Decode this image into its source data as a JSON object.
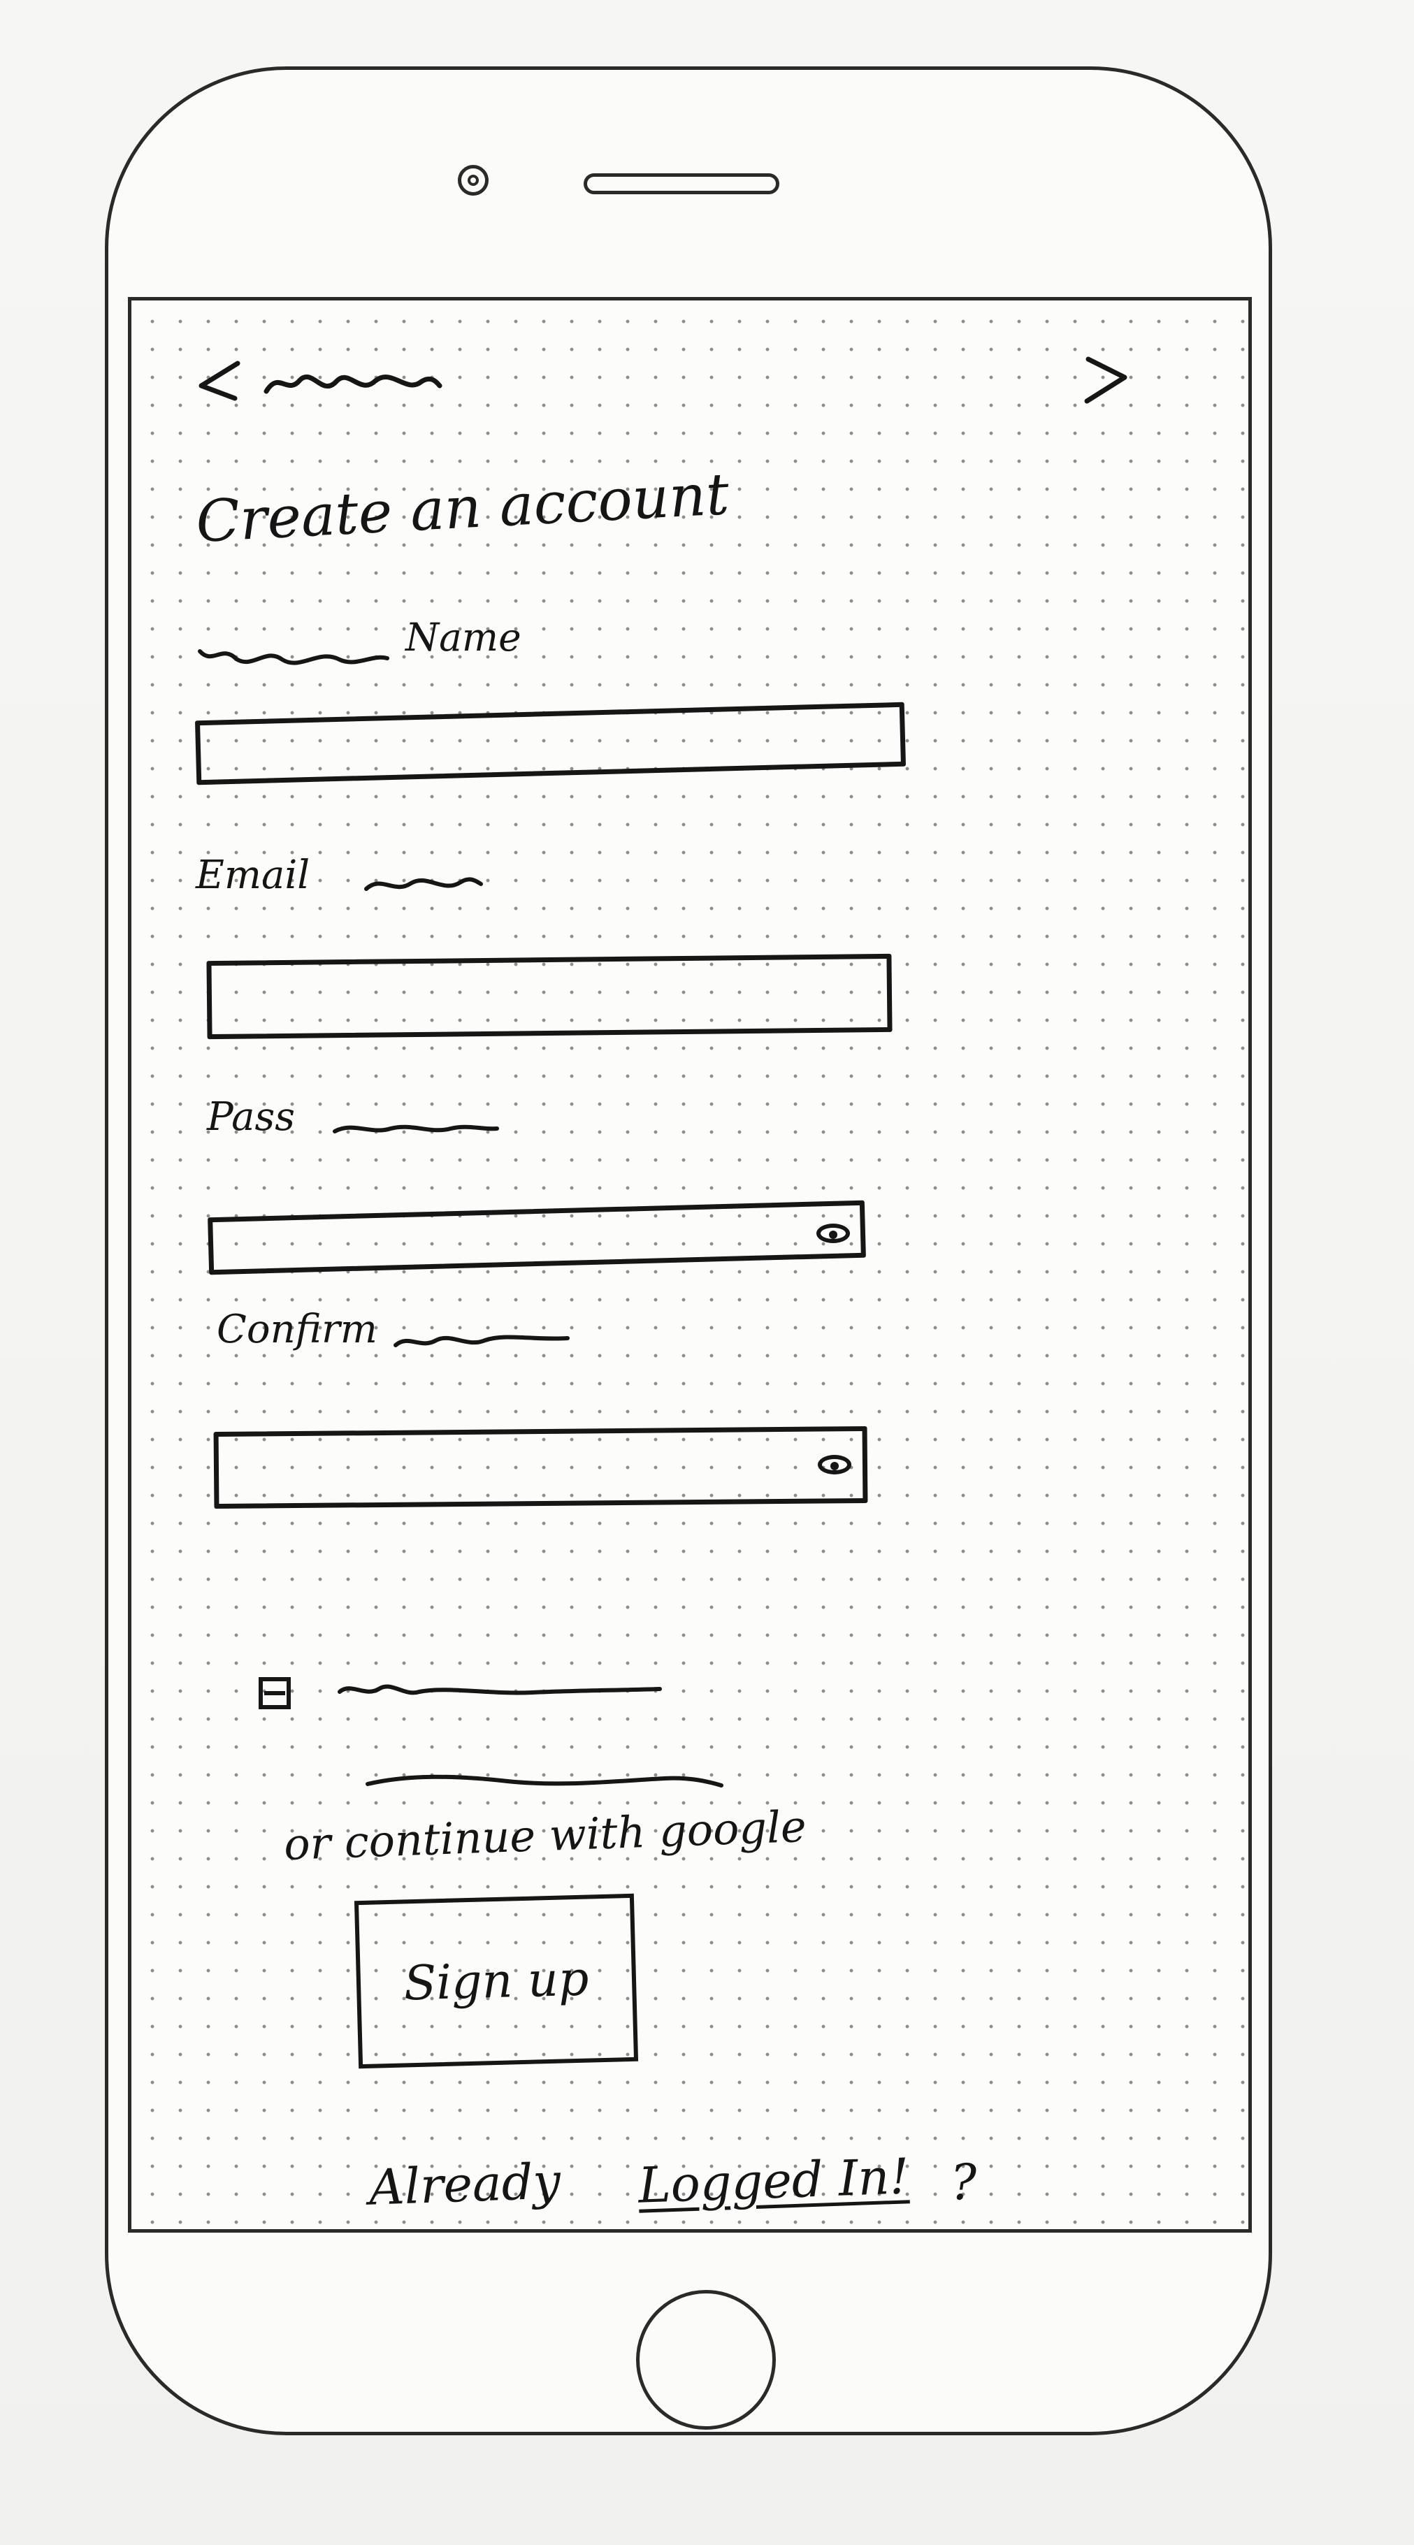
{
  "header": {
    "back_icon": "chevron-left-icon",
    "forward_icon": "chevron-right-icon"
  },
  "page": {
    "title": "Create an account"
  },
  "form": {
    "name_label": "Name",
    "email_label": "Email",
    "password_label": "Pass",
    "confirm_label": "Confirm",
    "password_visibility_icon": "eye-icon",
    "confirm_visibility_icon": "eye-icon",
    "checkbox_icon": "checkbox-icon"
  },
  "actions": {
    "google_label": "or continue with google",
    "signup_label": "Sign up",
    "already_text": "Already",
    "login_link": "Logged In!",
    "question_mark": "?"
  }
}
